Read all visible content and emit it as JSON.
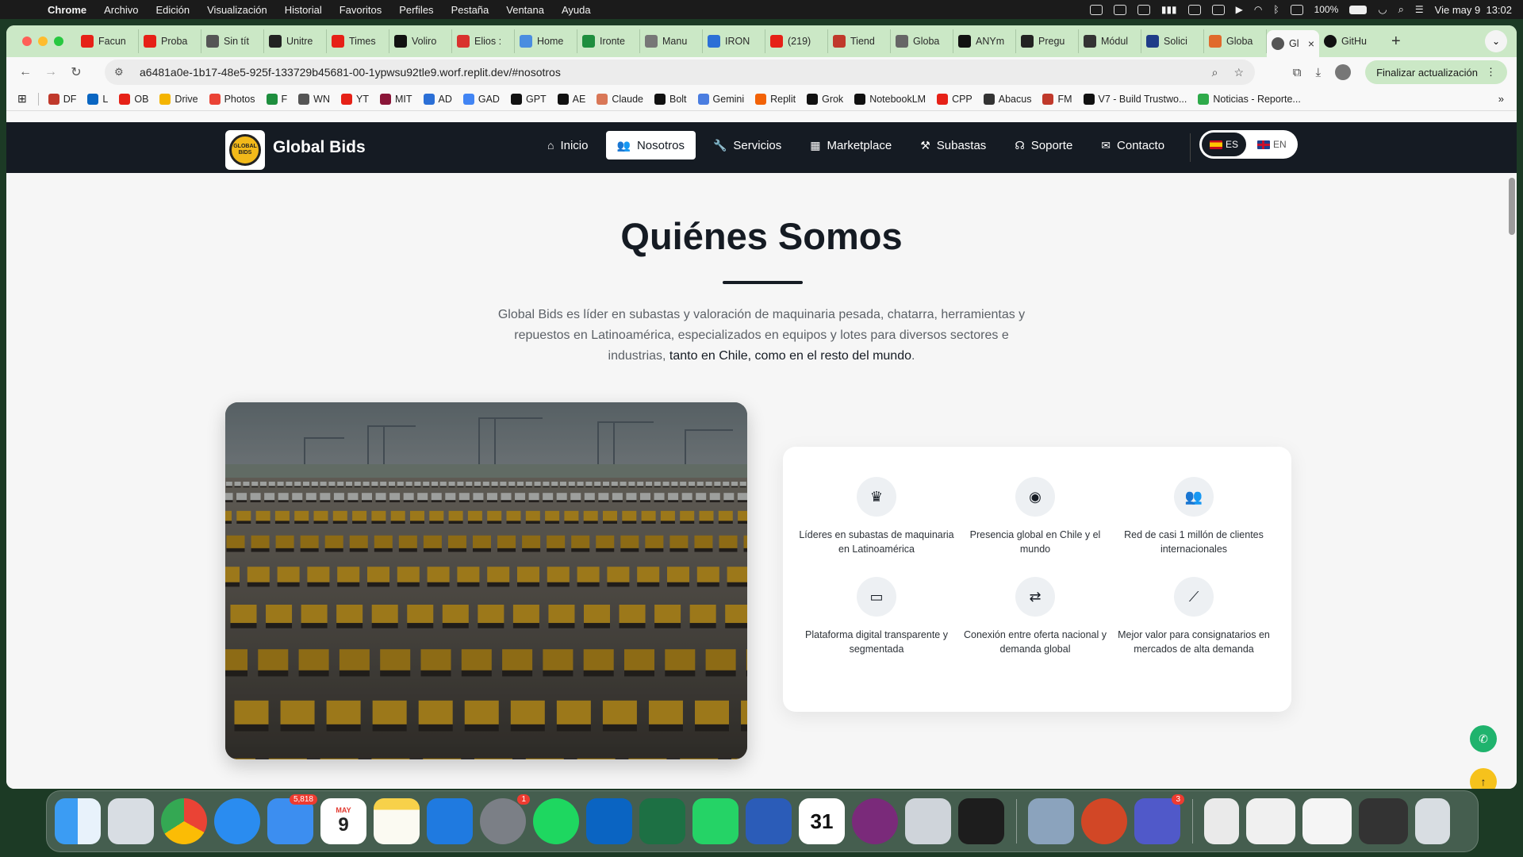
{
  "menubar": {
    "app": "Chrome",
    "menus": [
      "Archivo",
      "Edición",
      "Visualización",
      "Historial",
      "Favoritos",
      "Perfiles",
      "Pestaña",
      "Ventana",
      "Ayuda"
    ],
    "battery": "100%",
    "clock": "Vie may 9  13:02"
  },
  "tabs": [
    {
      "label": "Facun",
      "color": "#e62117"
    },
    {
      "label": "Proba",
      "color": "#e62117"
    },
    {
      "label": "Sin tít",
      "color": "#555"
    },
    {
      "label": "Unitre",
      "color": "#222"
    },
    {
      "label": "Times",
      "color": "#e62117"
    },
    {
      "label": "Voliro",
      "color": "#111"
    },
    {
      "label": "Elios :",
      "color": "#d9322e"
    },
    {
      "label": "Home",
      "color": "#4a8de0"
    },
    {
      "label": "Ironte",
      "color": "#1e8e3e"
    },
    {
      "label": "Manu",
      "color": "#777"
    },
    {
      "label": "IRON",
      "color": "#2b6fd6"
    },
    {
      "label": "(219)",
      "color": "#e62117"
    },
    {
      "label": "Tiend",
      "color": "#c0392b"
    },
    {
      "label": "Globa",
      "color": "#666"
    },
    {
      "label": "ANYm",
      "color": "#111"
    },
    {
      "label": "Pregu",
      "color": "#222"
    },
    {
      "label": "Módul",
      "color": "#333"
    },
    {
      "label": "Solici",
      "color": "#1f3c88"
    },
    {
      "label": "Globa",
      "color": "#e06a2c"
    }
  ],
  "active_tab": {
    "label": "Gl",
    "close": "×"
  },
  "last_tab": {
    "label": "GitHu"
  },
  "address": {
    "url": "a6481a0e-1b17-48e5-925f-133729b45681-00-1ypwsu92tle9.worf.replit.dev/#nosotros"
  },
  "update_button": "Finalizar actualización",
  "bookmarks": [
    {
      "label": "DF",
      "color": "#c0392b"
    },
    {
      "label": "L",
      "color": "#0a66c2"
    },
    {
      "label": "OB",
      "color": "#e62117"
    },
    {
      "label": "Drive",
      "color": "#f4b400"
    },
    {
      "label": "Photos",
      "color": "#ea4335"
    },
    {
      "label": "F",
      "color": "#1e8e3e"
    },
    {
      "label": "WN",
      "color": "#555"
    },
    {
      "label": "YT",
      "color": "#e62117"
    },
    {
      "label": "MIT",
      "color": "#8a1538"
    },
    {
      "label": "AD",
      "color": "#2b6fd6"
    },
    {
      "label": "GAD",
      "color": "#4285f4"
    },
    {
      "label": "GPT",
      "color": "#111"
    },
    {
      "label": "AE",
      "color": "#111"
    },
    {
      "label": "Claude",
      "color": "#d97757"
    },
    {
      "label": "Bolt",
      "color": "#111"
    },
    {
      "label": "Gemini",
      "color": "#4a7de0"
    },
    {
      "label": "Replit",
      "color": "#f26207"
    },
    {
      "label": "Grok",
      "color": "#111"
    },
    {
      "label": "NotebookLM",
      "color": "#111"
    },
    {
      "label": "CPP",
      "color": "#e62117"
    },
    {
      "label": "Abacus",
      "color": "#333"
    },
    {
      "label": "FM",
      "color": "#c0392b"
    },
    {
      "label": "V7 - Build Trustwo...",
      "color": "#111"
    },
    {
      "label": "Noticias - Reporte...",
      "color": "#2eaa4a"
    }
  ],
  "site": {
    "brand": "Global Bids",
    "logo_text": "GLOBAL BIDS",
    "nav": [
      {
        "label": "Inicio",
        "icon": "home-icon",
        "active": false
      },
      {
        "label": "Nosotros",
        "icon": "users-icon",
        "active": true
      },
      {
        "label": "Servicios",
        "icon": "wrench-icon",
        "active": false
      },
      {
        "label": "Marketplace",
        "icon": "grid-icon",
        "active": false
      },
      {
        "label": "Subastas",
        "icon": "gavel-icon",
        "active": false
      },
      {
        "label": "Soporte",
        "icon": "headset-icon",
        "active": false
      },
      {
        "label": "Contacto",
        "icon": "envelope-icon",
        "active": false
      }
    ],
    "lang": {
      "es": "ES",
      "en": "EN",
      "selected": "ES"
    }
  },
  "about": {
    "title": "Quiénes Somos",
    "intro_plain": "Global Bids es líder en subastas y valoración de maquinaria pesada, chatarra, herramientas y repuestos en Latinoamérica, especializados en equipos y lotes para diversos sectores e industrias, ",
    "intro_strong": "tanto en Chile, como en el resto del mundo",
    "intro_end": ".",
    "features": [
      {
        "icon": "crown-icon",
        "text": "Líderes en subastas de maquinaria en Latinoamérica"
      },
      {
        "icon": "globe-icon",
        "text": "Presencia global en Chile y el mundo"
      },
      {
        "icon": "users-icon",
        "text": "Red de casi 1 millón de clientes internacionales"
      },
      {
        "icon": "laptop-icon",
        "text": "Plataforma digital transparente y segmentada"
      },
      {
        "icon": "exchange-icon",
        "text": "Conexión entre oferta nacional y demanda global"
      },
      {
        "icon": "chart-line-icon",
        "text": "Mejor valor para consignatarios en mercados de alta demanda"
      }
    ]
  },
  "dock": {
    "mail_badge": "5,818",
    "calendar_month": "MAY",
    "calendar_day": "9",
    "settings_badge": "1",
    "teams_badge": "3",
    "date_icon_day": "31"
  }
}
